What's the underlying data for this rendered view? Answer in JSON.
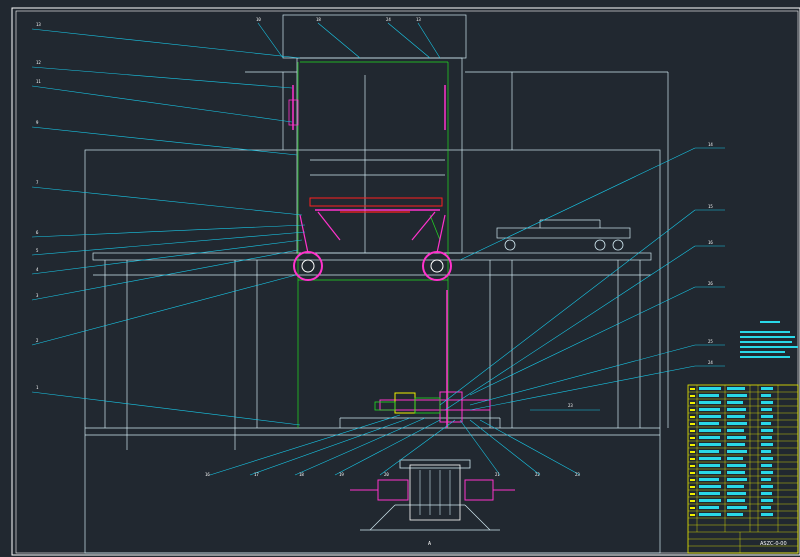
{
  "drawing": {
    "colors": {
      "background": "#212830",
      "frame": "#ffffff",
      "outline": "#cfe7f0",
      "leader": "#18c8e8",
      "green": "#22dd22",
      "magenta": "#ff33cc",
      "red": "#ff2020",
      "yellow": "#f0f000",
      "table_cell": "#29d8e8"
    },
    "left_labels": [
      "13",
      "12",
      "11",
      "9",
      "7",
      "6",
      "5",
      "4",
      "3",
      "2",
      "1"
    ],
    "bottom_labels": [
      "16",
      "17",
      "18",
      "19",
      "20",
      "21",
      "22",
      "23"
    ],
    "right_labels": [
      "14",
      "15",
      "16",
      "26",
      "25",
      "24",
      "23"
    ],
    "top_labels": [
      "10",
      "18",
      "24",
      "13"
    ],
    "section_mark": "A",
    "title_block": {
      "drawing_number": "ASZC-0-00"
    }
  }
}
